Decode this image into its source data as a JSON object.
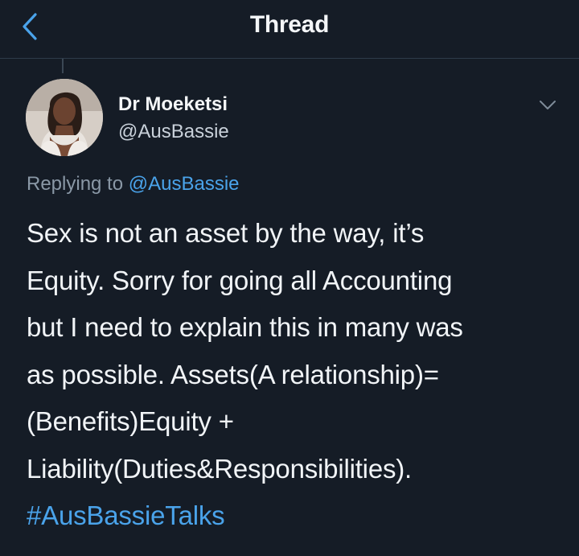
{
  "header": {
    "title": "Thread",
    "back_icon": "chevron-left-icon",
    "accent_color": "#4aa3ea"
  },
  "tweet": {
    "author": {
      "name": "Dr Moeketsi",
      "handle": "@AusBassie"
    },
    "menu_icon": "chevron-down-icon",
    "replying_prefix": "Replying to",
    "replying_to": "@AusBassie",
    "text_lines": [
      "Sex is not an asset by the way, it’s",
      "Equity. Sorry for going all Accounting",
      "but I need to explain this in many was",
      "as possible. Assets(A relationship)=",
      "(Benefits)Equity +",
      "Liability(Duties&Responsibilities)."
    ],
    "hashtag": "#AusBassieTalks"
  },
  "colors": {
    "background": "#151c26",
    "link": "#4aa3ea",
    "text": "#f1f4f7",
    "muted": "#8a98a6"
  }
}
